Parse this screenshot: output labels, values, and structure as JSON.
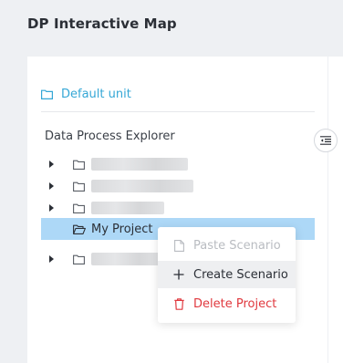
{
  "app": {
    "title": "DP Interactive Map"
  },
  "tab": {
    "label": "Default unit",
    "icon": "folder-outline-icon",
    "accent": "#35a7d6"
  },
  "explorer": {
    "title": "Data Process Explorer",
    "collapse_icon": "indent-list-icon",
    "items": [
      {
        "label": "",
        "expandable": true,
        "redacted": true
      },
      {
        "label": "",
        "expandable": true,
        "redacted": true
      },
      {
        "label": "",
        "expandable": true,
        "redacted": true
      },
      {
        "label": "My Project",
        "expandable": false,
        "selected": true,
        "icon": "folder-open-icon"
      },
      {
        "label": "",
        "expandable": true,
        "redacted": true
      }
    ]
  },
  "context_menu": {
    "items": [
      {
        "label": "Paste Scenario",
        "icon": "paste-icon",
        "state": "disabled"
      },
      {
        "label": "Create Scenario",
        "icon": "plus-icon",
        "state": "hover"
      },
      {
        "label": "Delete Project",
        "icon": "trash-icon",
        "state": "danger"
      }
    ]
  },
  "colors": {
    "selected_row": "#add8f7",
    "danger": "#e0383e",
    "background": "#eef0f3"
  }
}
